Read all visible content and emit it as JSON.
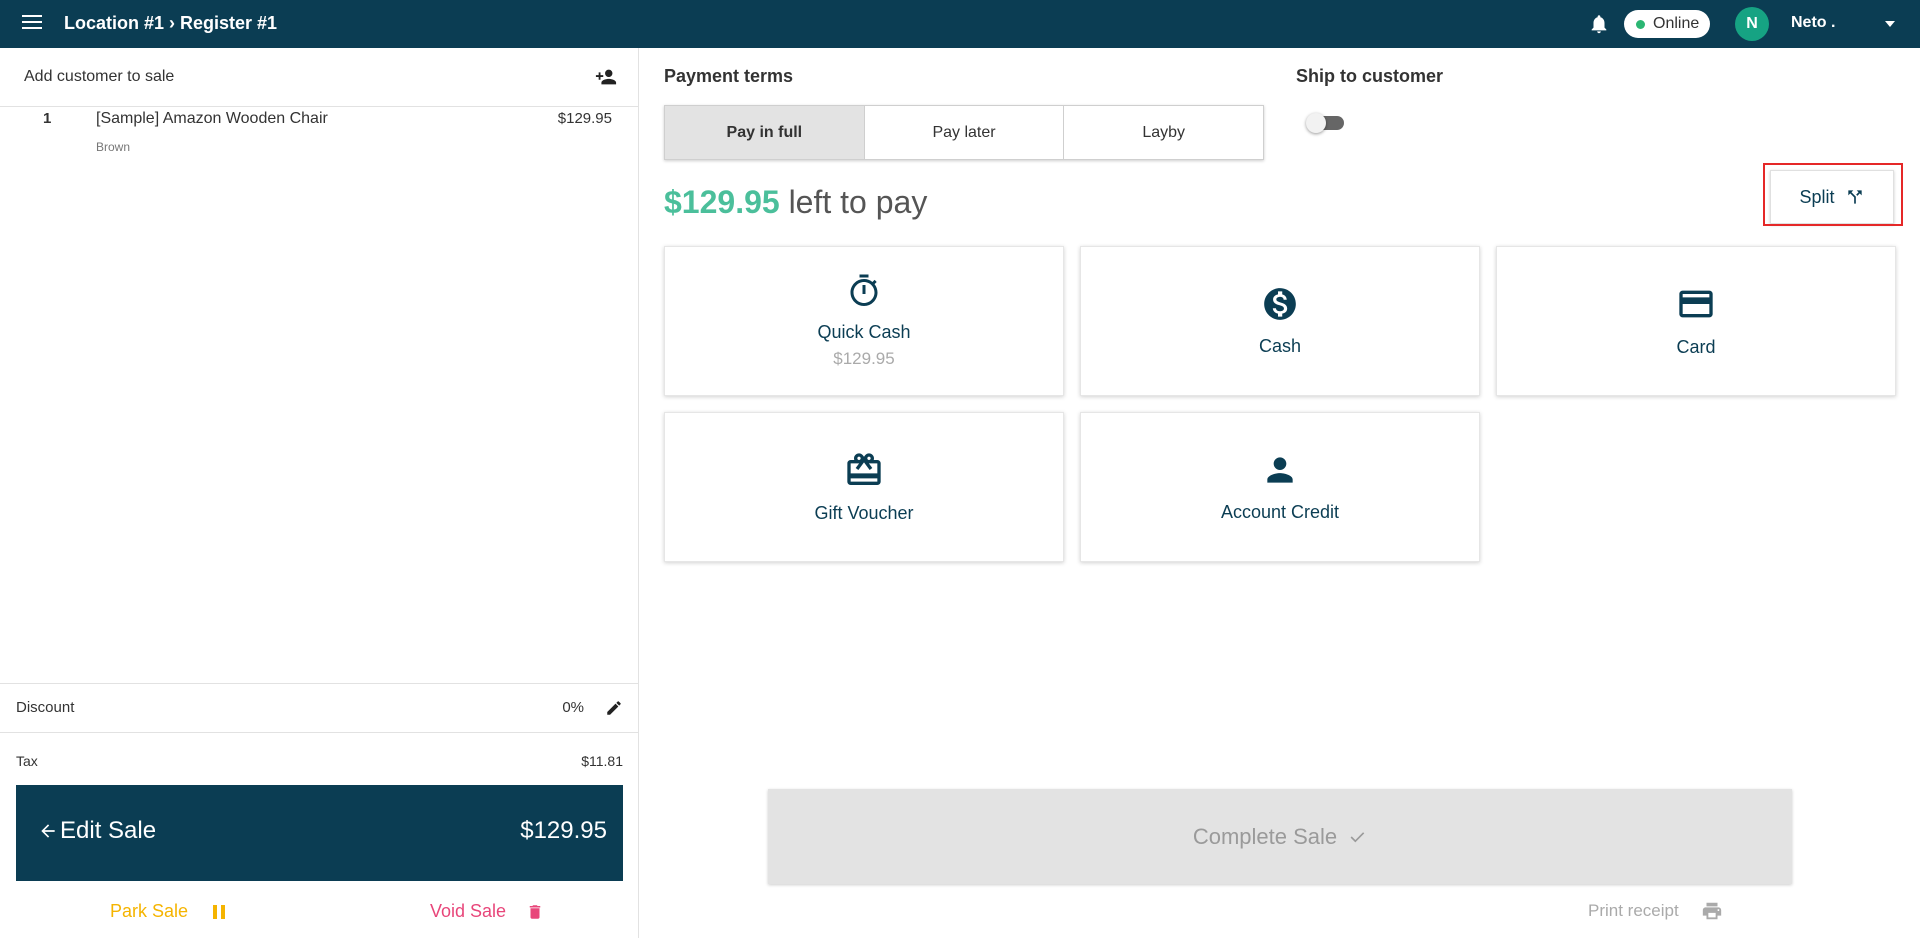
{
  "header": {
    "breadcrumb": "Location #1 › Register #1",
    "status": "Online",
    "status_color": "#2bb673",
    "avatar_initial": "N",
    "avatar_color": "#16a383",
    "user_name": "Neto .",
    "icons": [
      "menu-icon",
      "bell-icon",
      "chevron-down-icon"
    ]
  },
  "cart": {
    "add_customer_label": "Add customer to sale",
    "items": [
      {
        "qty": "1",
        "name": "[Sample] Amazon Wooden Chair",
        "variant": "Brown",
        "price": "$129.95"
      }
    ],
    "discount_label": "Discount",
    "discount_value": "0%",
    "tax_label": "Tax",
    "tax_value": "$11.81",
    "edit_sale_label": "Edit Sale",
    "total": "$129.95",
    "park_label": "Park Sale",
    "void_label": "Void Sale",
    "park_color": "#f5b400",
    "void_color": "#e8467a"
  },
  "payment": {
    "terms_title": "Payment terms",
    "terms": [
      "Pay in full",
      "Pay later",
      "Layby"
    ],
    "active_term": "Pay in full",
    "ship_title": "Ship to customer",
    "ship_enabled": false,
    "left_amount": "$129.95",
    "left_suffix": "left to pay",
    "left_amount_color": "#4bbf9b",
    "split_label": "Split",
    "methods": [
      {
        "label": "Quick Cash",
        "sub": "$129.95",
        "icon": "timer-icon"
      },
      {
        "label": "Cash",
        "sub": "",
        "icon": "dollar-circle-icon"
      },
      {
        "label": "Card",
        "sub": "",
        "icon": "credit-card-icon"
      },
      {
        "label": "Gift Voucher",
        "sub": "",
        "icon": "gift-card-icon"
      },
      {
        "label": "Account Credit",
        "sub": "",
        "icon": "person-icon"
      }
    ],
    "complete_label": "Complete Sale",
    "print_label": "Print receipt"
  },
  "colors": {
    "brand": "#0b3d53",
    "highlight": "#e52828"
  }
}
